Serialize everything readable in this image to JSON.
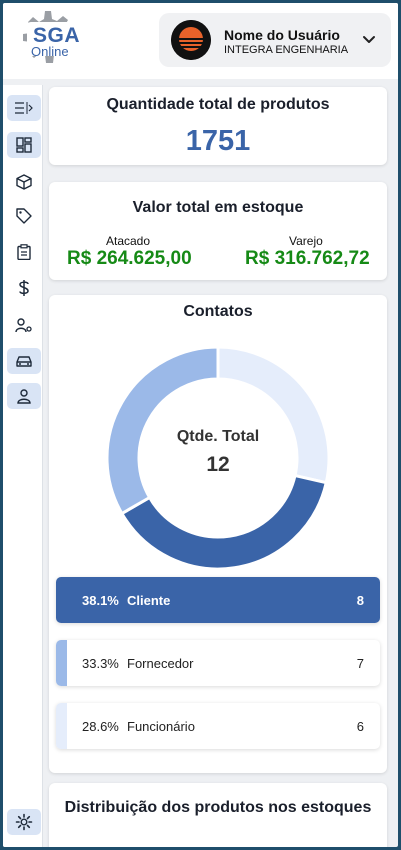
{
  "header": {
    "logo": {
      "brand": "SGA",
      "subtitle": "Online"
    },
    "user": {
      "name": "Nome do Usuário",
      "company": "INTEGRA ENGENHARIA"
    },
    "icons": {
      "dropdown": "chevron-down-icon"
    }
  },
  "sidebar": {
    "items": [
      {
        "icon": "collapse-menu-icon"
      },
      {
        "icon": "dashboard-icon",
        "active": true
      },
      {
        "icon": "box-icon"
      },
      {
        "icon": "tag-icon"
      },
      {
        "icon": "clipboard-icon"
      },
      {
        "icon": "dollar-icon"
      },
      {
        "icon": "user-gear-icon"
      },
      {
        "icon": "car-icon"
      },
      {
        "icon": "user-icon"
      },
      {
        "icon": "settings-icon"
      }
    ]
  },
  "cards": {
    "products": {
      "title": "Quantidade total de produtos",
      "value": "1751"
    },
    "stock": {
      "title": "Valor total em estoque",
      "wholesale_label": "Atacado",
      "wholesale_value": "R$ 264.625,00",
      "retail_label": "Varejo",
      "retail_value": "R$ 316.762,72"
    },
    "contacts": {
      "title": "Contatos",
      "center_label": "Qtde. Total",
      "center_value": "12",
      "legend": [
        {
          "pct": "38.1%",
          "name": "Cliente",
          "count": "8",
          "color": "#3a64a8",
          "selected": true
        },
        {
          "pct": "33.3%",
          "name": "Fornecedor",
          "count": "7",
          "color": "#9bb9e8",
          "selected": false
        },
        {
          "pct": "28.6%",
          "name": "Funcionário",
          "count": "6",
          "color": "#e5edfb",
          "selected": false
        }
      ]
    },
    "distribution": {
      "title": "Distribuição dos produtos nos estoques"
    }
  },
  "chart_data": {
    "type": "pie",
    "categories": [
      "Cliente",
      "Fornecedor",
      "Funcionário"
    ],
    "values": [
      8,
      7,
      6
    ],
    "percentages": [
      38.1,
      33.3,
      28.6
    ],
    "colors": [
      "#3a64a8",
      "#9bb9e8",
      "#e5edfb"
    ],
    "title": "Contatos"
  },
  "colors": {
    "accent": "#3a64a8",
    "money": "#168a16"
  }
}
